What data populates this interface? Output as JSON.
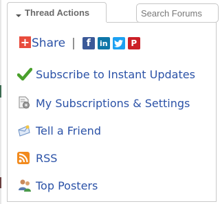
{
  "toolbar": {
    "thread_actions_label": "Thread Actions",
    "search_placeholder": "Search Forums"
  },
  "share": {
    "label": "Share",
    "separator": "|",
    "plus_glyph": "+",
    "icons": [
      {
        "name": "facebook",
        "glyph": "f",
        "color": "#3b5998"
      },
      {
        "name": "linkedin",
        "glyph": "in",
        "color": "#0e76a8"
      },
      {
        "name": "twitter",
        "color": "#1da1f2"
      },
      {
        "name": "pinterest",
        "glyph": "P",
        "color": "#cb2027"
      }
    ]
  },
  "menu": {
    "items": [
      {
        "label": "Subscribe to Instant Updates",
        "icon": "checkmark-icon"
      },
      {
        "label": "My Subscriptions & Settings",
        "icon": "subscription-settings-icon"
      },
      {
        "label": "Tell a Friend",
        "icon": "envelope-icon"
      },
      {
        "label": "RSS",
        "icon": "rss-icon"
      },
      {
        "label": "Top Posters",
        "icon": "top-posters-icon"
      }
    ]
  },
  "colors": {
    "link": "#2b52a7",
    "border": "#c9c9c9",
    "check": "#4aa02c",
    "rss": "#f28a1d"
  }
}
